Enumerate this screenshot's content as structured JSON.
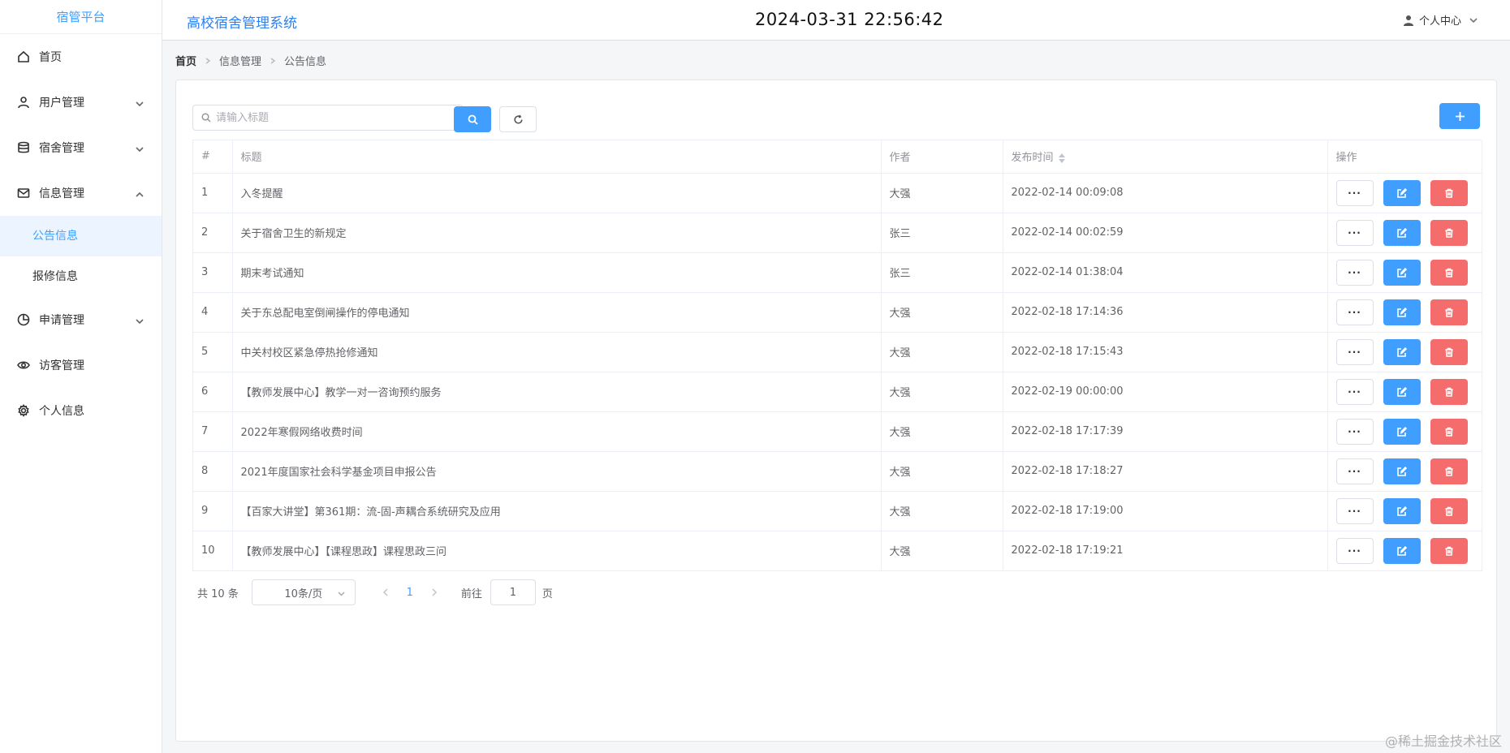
{
  "sidebar": {
    "brand": "宿管平台",
    "items": [
      {
        "label": "首页",
        "icon": "home-icon"
      },
      {
        "label": "用户管理",
        "icon": "user-icon"
      },
      {
        "label": "宿舍管理",
        "icon": "database-icon"
      },
      {
        "label": "信息管理",
        "icon": "message-icon"
      },
      {
        "label": "申请管理",
        "icon": "pie-chart-icon"
      },
      {
        "label": "访客管理",
        "icon": "eye-icon"
      },
      {
        "label": "个人信息",
        "icon": "gear-icon"
      }
    ],
    "sub_items": [
      {
        "label": "公告信息",
        "active": true
      },
      {
        "label": "报修信息",
        "active": false
      }
    ]
  },
  "header": {
    "title": "高校宿舍管理系统",
    "clock": "2024-03-31 22:56:42",
    "user_label": "个人中心"
  },
  "breadcrumb": [
    "首页",
    "信息管理",
    "公告信息"
  ],
  "search": {
    "placeholder": "请输入标题",
    "value": ""
  },
  "table": {
    "columns": [
      "#",
      "标题",
      "作者",
      "发布时间",
      "操作"
    ],
    "rows": [
      {
        "id": "1",
        "title": "入冬提醒",
        "author": "大强",
        "time": "2022-02-14 00:09:08"
      },
      {
        "id": "2",
        "title": "关于宿舍卫生的新规定",
        "author": "张三",
        "time": "2022-02-14 00:02:59"
      },
      {
        "id": "3",
        "title": "期末考试通知",
        "author": "张三",
        "time": "2022-02-14 01:38:04"
      },
      {
        "id": "4",
        "title": "关于东总配电室倒闸操作的停电通知",
        "author": "大强",
        "time": "2022-02-18 17:14:36"
      },
      {
        "id": "5",
        "title": "中关村校区紧急停热抢修通知",
        "author": "大强",
        "time": "2022-02-18 17:15:43"
      },
      {
        "id": "6",
        "title": "【教师发展中心】教学一对一咨询预约服务",
        "author": "大强",
        "time": "2022-02-19 00:00:00"
      },
      {
        "id": "7",
        "title": "2022年寒假网络收费时间",
        "author": "大强",
        "time": "2022-02-18 17:17:39"
      },
      {
        "id": "8",
        "title": "2021年度国家社会科学基金项目申报公告",
        "author": "大强",
        "time": "2022-02-18 17:18:27"
      },
      {
        "id": "9",
        "title": "【百家大讲堂】第361期：流-固-声耦合系统研究及应用",
        "author": "大强",
        "time": "2022-02-18 17:19:00"
      },
      {
        "id": "10",
        "title": "【教师发展中心】【课程思政】课程思政三问",
        "author": "大强",
        "time": "2022-02-18 17:19:21"
      }
    ],
    "more_label": "···"
  },
  "pagination": {
    "total": "共 10 条",
    "page_size": "10条/页",
    "current_page": "1",
    "jump_label": "前往",
    "jump_value": "1",
    "jump_suffix": "页"
  },
  "watermark": "@稀土掘金技术社区",
  "colors": {
    "primary": "#409eff",
    "danger": "#f56c6c",
    "active_bg": "#ecf5ff"
  }
}
